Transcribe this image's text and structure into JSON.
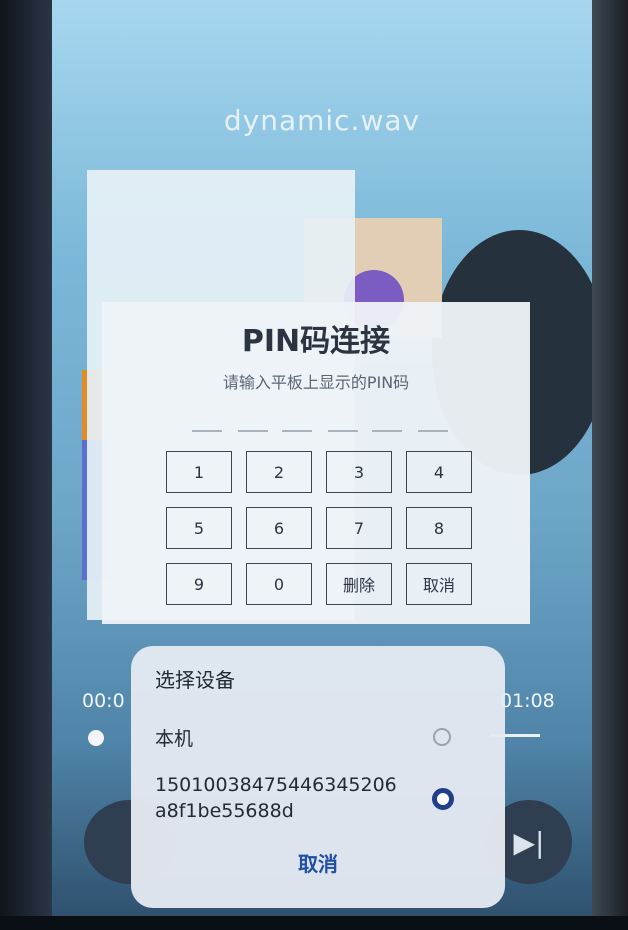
{
  "player": {
    "title": "dynamic.wav",
    "time_elapsed": "00:0",
    "time_total": "01:08",
    "next_icon": "skip-next-icon"
  },
  "pin_dialog": {
    "title": "PIN码连接",
    "subtitle": "请输入平板上显示的PIN码",
    "keys": [
      "1",
      "2",
      "3",
      "4",
      "5",
      "6",
      "7",
      "8",
      "9",
      "0",
      "删除",
      "取消"
    ]
  },
  "device_sheet": {
    "title": "选择设备",
    "options": [
      {
        "label": "本机",
        "selected": false
      },
      {
        "label_line1": "15010038475446345206",
        "label_line2": "a8f1be55688d",
        "selected": true
      }
    ],
    "cancel": "取消"
  },
  "colors": {
    "accent": "#1f4fa6",
    "radio_selected": "#1f3f8a"
  }
}
